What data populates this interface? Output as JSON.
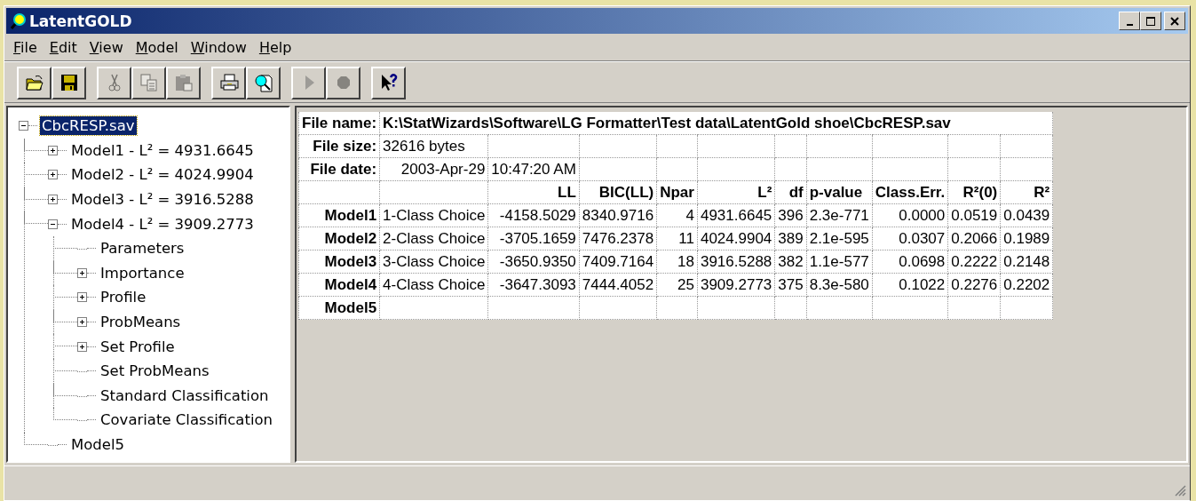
{
  "window": {
    "title": "LatentGOLD"
  },
  "menu": [
    "File",
    "Edit",
    "View",
    "Model",
    "Window",
    "Help"
  ],
  "toolbar": [
    [
      {
        "kind": "open",
        "disabled": false
      },
      {
        "kind": "save",
        "disabled": false
      }
    ],
    [
      {
        "kind": "cut",
        "disabled": true
      },
      {
        "kind": "copy",
        "disabled": true
      },
      {
        "kind": "paste",
        "disabled": true
      }
    ],
    [
      {
        "kind": "print",
        "disabled": false
      },
      {
        "kind": "preview",
        "disabled": false
      }
    ],
    [
      {
        "kind": "run",
        "disabled": true
      },
      {
        "kind": "stop",
        "disabled": true
      }
    ],
    [
      {
        "kind": "help",
        "disabled": false
      }
    ]
  ],
  "tree": [
    {
      "label": "CbcRESP.sav",
      "selected": true,
      "expanded": true,
      "children": [
        {
          "label": "Model1 - L² = 4931.6645",
          "selected": false,
          "expanded": false
        },
        {
          "label": "Model2 - L² = 4024.9904",
          "selected": false,
          "expanded": false
        },
        {
          "label": "Model3 - L² = 3916.5288",
          "selected": false,
          "expanded": false
        },
        {
          "label": "Model4 - L² = 3909.2773",
          "selected": false,
          "expanded": true,
          "children": [
            {
              "label": "Parameters",
              "selected": false
            },
            {
              "label": "Importance",
              "selected": false,
              "expanded": false
            },
            {
              "label": "Profile",
              "selected": false,
              "expanded": false
            },
            {
              "label": "ProbMeans",
              "selected": false,
              "expanded": false
            },
            {
              "label": "Set Profile",
              "selected": false,
              "expanded": false
            },
            {
              "label": "Set ProbMeans",
              "selected": false
            },
            {
              "label": "Standard Classification",
              "selected": false
            },
            {
              "label": "Covariate Classification",
              "selected": false
            }
          ]
        },
        {
          "label": "Model5",
          "selected": false
        }
      ]
    }
  ],
  "file_info": [
    {
      "label": "File name:",
      "values": [
        "K:\\StatWizards\\Software\\LG Formatter\\Test data\\LatentGold shoe\\CbcRESP.sav"
      ]
    },
    {
      "label": "File size:",
      "values": [
        "32616 bytes"
      ]
    },
    {
      "label": "File date:",
      "values": [
        "2003-Apr-29",
        "10:47:20 AM"
      ]
    }
  ],
  "table": {
    "columns": [
      "LL",
      "BIC(LL)",
      "Npar",
      "L²",
      "df",
      "p-value",
      "Class.Err.",
      "R²(0)",
      "R²"
    ],
    "rows": [
      {
        "model": "Model1",
        "description": "1-Class Choice",
        "values": [
          "-4158.5029",
          "8340.9716",
          "4",
          "4931.6645",
          "396",
          "2.3e-771",
          "0.0000",
          "0.0519",
          "0.0439"
        ]
      },
      {
        "model": "Model2",
        "description": "2-Class Choice",
        "values": [
          "-3705.1659",
          "7476.2378",
          "11",
          "4024.9904",
          "389",
          "2.1e-595",
          "0.0307",
          "0.2066",
          "0.1989"
        ]
      },
      {
        "model": "Model3",
        "description": "3-Class Choice",
        "values": [
          "-3650.9350",
          "7409.7164",
          "18",
          "3916.5288",
          "382",
          "1.1e-577",
          "0.0698",
          "0.2222",
          "0.2148"
        ]
      },
      {
        "model": "Model4",
        "description": "4-Class Choice",
        "values": [
          "-3647.3093",
          "7444.4052",
          "25",
          "3909.2773",
          "375",
          "8.3e-580",
          "0.1022",
          "0.2276",
          "0.2202"
        ]
      },
      {
        "model": "Model5"
      }
    ]
  }
}
